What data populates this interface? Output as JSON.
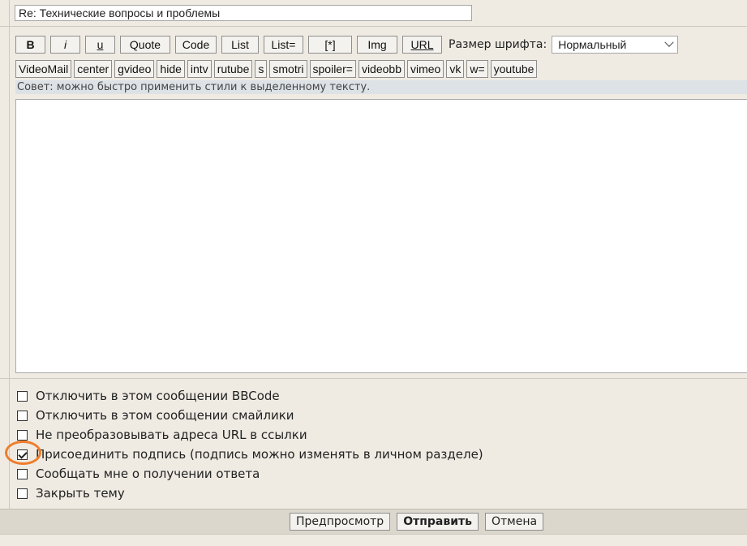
{
  "subject": {
    "value": "Re: Технические вопросы и проблемы"
  },
  "toolbar": {
    "row1": [
      "B",
      "i",
      "u",
      "Quote",
      "Code",
      "List",
      "List=",
      "[*]",
      "Img",
      "URL"
    ],
    "font_size_label": "Размер шрифта:",
    "font_size_selected": "Нормальный",
    "row2": [
      "VideoMail",
      "center",
      "gvideo",
      "hide",
      "intv",
      "rutube",
      "s",
      "smotri",
      "spoiler=",
      "videobb",
      "vimeo",
      "vk",
      "w=",
      "youtube"
    ]
  },
  "hint": "Совет: можно быстро применить стили к выделенному тексту.",
  "editor": {
    "value": ""
  },
  "options": [
    {
      "label": "Отключить в этом сообщении BBCode",
      "checked": false
    },
    {
      "label": "Отключить в этом сообщении смайлики",
      "checked": false
    },
    {
      "label": "Не преобразовывать адреса URL в ссылки",
      "checked": false
    },
    {
      "label": "Присоединить подпись (подпись можно изменять в личном разделе)",
      "checked": true
    },
    {
      "label": "Сообщать мне о получении ответа",
      "checked": false
    },
    {
      "label": "Закрыть тему",
      "checked": false
    }
  ],
  "footer": {
    "preview": "Предпросмотр",
    "submit": "Отправить",
    "cancel": "Отмена"
  },
  "colors": {
    "highlight_ring": "#ef7d2c",
    "hint_bg": "#dde2e6",
    "page_bg": "#efebe3"
  }
}
